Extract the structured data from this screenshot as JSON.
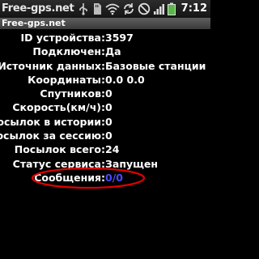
{
  "status_bar": {
    "app_name": "Free-gps.net",
    "time": "7:12",
    "icons": [
      "usb-icon",
      "sd-card-icon",
      "wifi-icon",
      "sync-icon",
      "no-sim-icon",
      "signal-icon",
      "battery-icon"
    ]
  },
  "title": "Free-gps.net",
  "rows": [
    {
      "label": "ID устройства:",
      "value": "3597"
    },
    {
      "label": "Подключен:",
      "value": "Да"
    },
    {
      "label": "Источник данных:",
      "value": "Базовые станции"
    },
    {
      "label": "Координаты:",
      "value": "0.0 0.0"
    },
    {
      "label": "Спутников:",
      "value": "0"
    },
    {
      "label": "Скорость(км/ч):",
      "value": "0"
    },
    {
      "label": "Посылок в истории:",
      "value": "0"
    },
    {
      "label": "Посылок за сессию:",
      "value": "0"
    },
    {
      "label": "Посылок всего:",
      "value": "24"
    },
    {
      "label": "Статус сервиса:",
      "value": "Запущен"
    },
    {
      "label": "Сообщения:",
      "value": "0/0"
    }
  ],
  "colors": {
    "background": "#000000",
    "text": "#ffffff",
    "messages_value": "#4a4aff",
    "highlight_ellipse": "#e00000"
  }
}
